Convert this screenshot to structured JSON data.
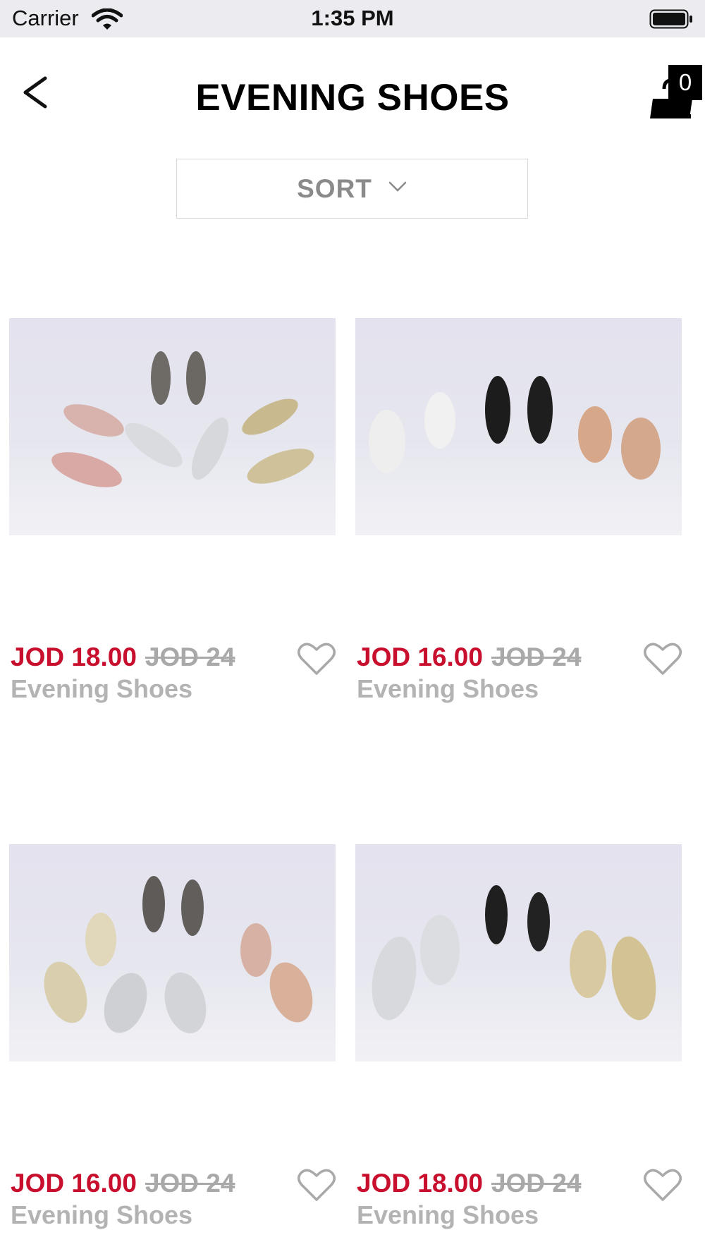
{
  "status_bar": {
    "carrier": "Carrier",
    "time": "1:35 PM"
  },
  "header": {
    "title": "EVENING SHOES",
    "cart_count": "0"
  },
  "sort": {
    "label": "SORT"
  },
  "colors": {
    "price": "#c8102e",
    "old_price": "#a9a9a9",
    "name": "#b3b3b3"
  },
  "icons": {
    "back": "chevron-left-icon",
    "cart": "shopping-bag-icon",
    "sort": "chevron-down-icon",
    "favorite": "heart-outline-icon"
  },
  "products": [
    {
      "price": "JOD 18.00",
      "old_price": "JOD 24",
      "name": "Evening Shoes",
      "image": "metallic pointed-toe stiletto pumps"
    },
    {
      "price": "JOD 16.00",
      "old_price": "JOD 24",
      "name": "Evening Shoes",
      "image": "block-heel ankle strap sandals"
    },
    {
      "price": "JOD 16.00",
      "old_price": "JOD 24",
      "name": "Evening Shoes",
      "image": "square-toe clear-heel mules"
    },
    {
      "price": "JOD 18.00",
      "old_price": "JOD 24",
      "name": "Evening Shoes",
      "image": "strappy block-heel sandals"
    }
  ]
}
